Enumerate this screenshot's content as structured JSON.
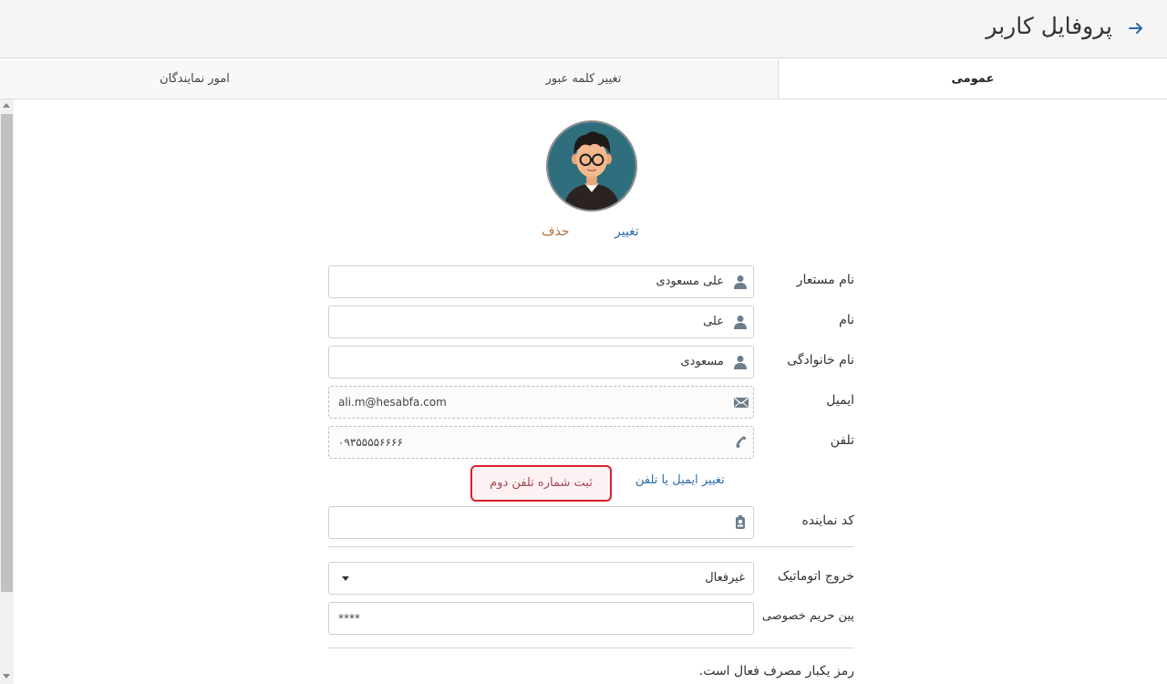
{
  "header": {
    "title": "پروفایل کاربر"
  },
  "tabs": {
    "general": "عمومی",
    "password": "تغییر کلمه عبور",
    "agency": "امور نمایندگان"
  },
  "avatar": {
    "change_label": "تغییر",
    "delete_label": "حذف"
  },
  "form": {
    "username": {
      "label": "نام مستعار",
      "value": "علی مسعودی"
    },
    "first_name": {
      "label": "نام",
      "value": "علی"
    },
    "last_name": {
      "label": "نام خانوادگی",
      "value": "مسعودی"
    },
    "email": {
      "label": "ایمیل",
      "value": "ali.m@hesabfa.com"
    },
    "phone": {
      "label": "تلفن",
      "value": "۰۹۳۵۵۵۵۶۶۶۶"
    },
    "change_email_phone": "تغییر ایمیل یا تلفن",
    "second_phone_button": "ثبت شماره تلفن دوم",
    "agent_code": {
      "label": "کد نماینده",
      "value": ""
    },
    "auto_logout": {
      "label": "خروج اتوماتیک",
      "value": "غیرفعال"
    },
    "privacy_pin": {
      "label": "پین حریم خصوصی",
      "value": "****"
    },
    "otp_status": "رمز یکبار مصرف فعال است."
  },
  "colors": {
    "link": "#2d6ba8",
    "delete_link": "#b0703a",
    "highlight_border": "#d9202c",
    "back_arrow": "#2d6ba8"
  }
}
